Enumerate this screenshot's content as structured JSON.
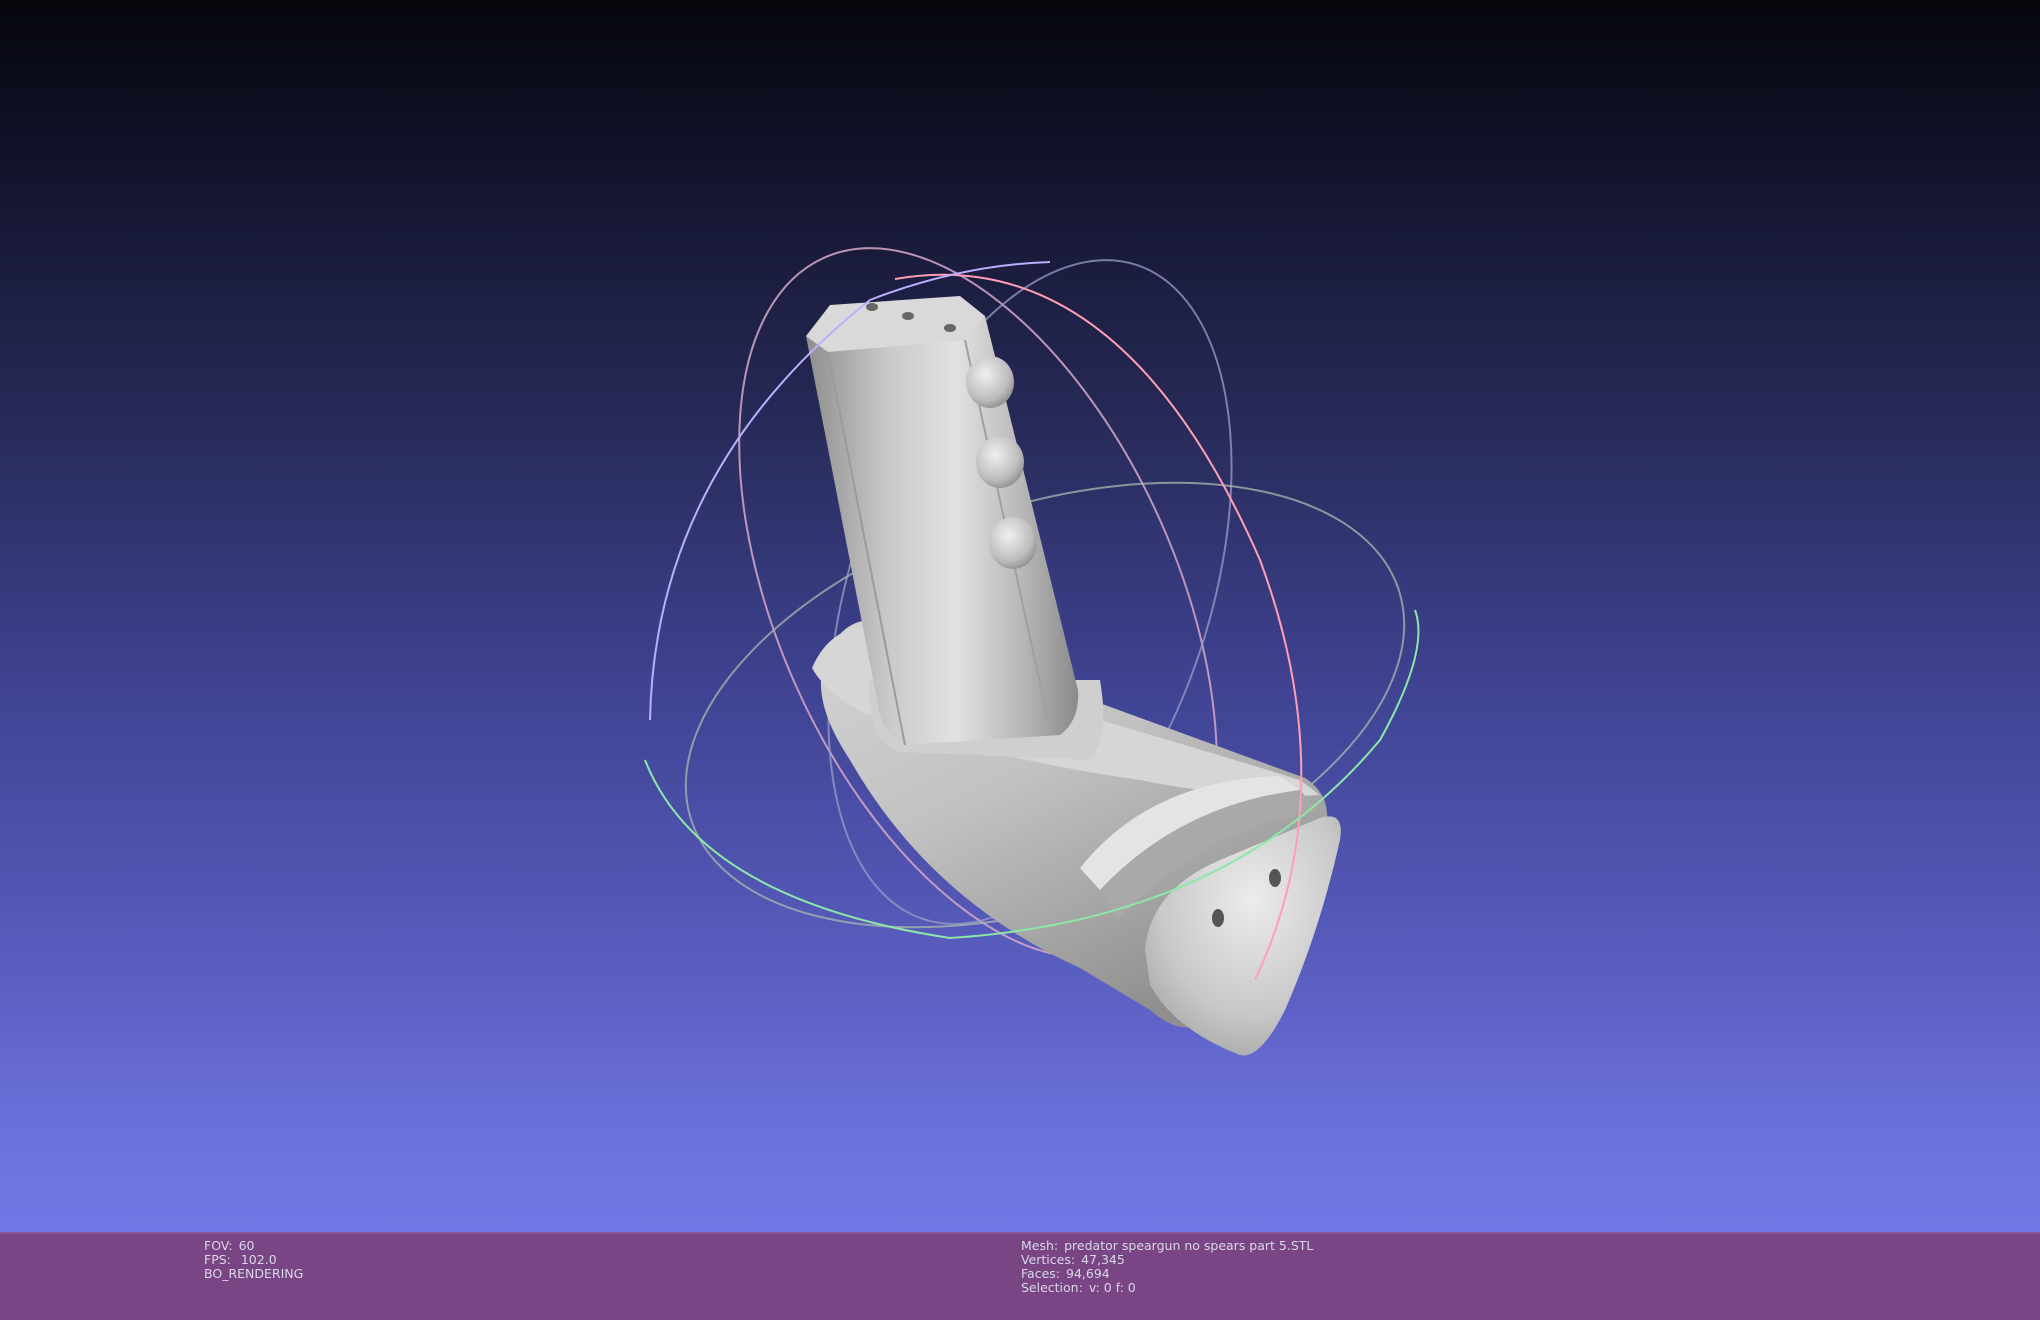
{
  "viewer": {
    "fov_label": "FOV:",
    "fov_value": "60",
    "fps_label": "FPS:",
    "fps_value": "102.0",
    "render_mode": "BO_RENDERING"
  },
  "mesh_info": {
    "mesh_label": "Mesh:",
    "mesh_name": "predator speargun no spears part 5.STL",
    "vertices_label": "Vertices:",
    "vertices_value": "47,345",
    "faces_label": "Faces:",
    "faces_value": "94,694",
    "selection_label": "Selection:",
    "selection_value": "v: 0 f: 0"
  },
  "colors": {
    "info_bar": "#7a4584",
    "background_top": "#05060c",
    "background_bottom": "#7478e6",
    "mesh": "#c8c8c8",
    "trackball_red": "#ff9a9a",
    "trackball_green": "#8ce8a0",
    "trackball_blue": "#a8a8ff"
  },
  "scene": {
    "objects": [
      "mesh-model",
      "trackball-gizmo"
    ]
  }
}
